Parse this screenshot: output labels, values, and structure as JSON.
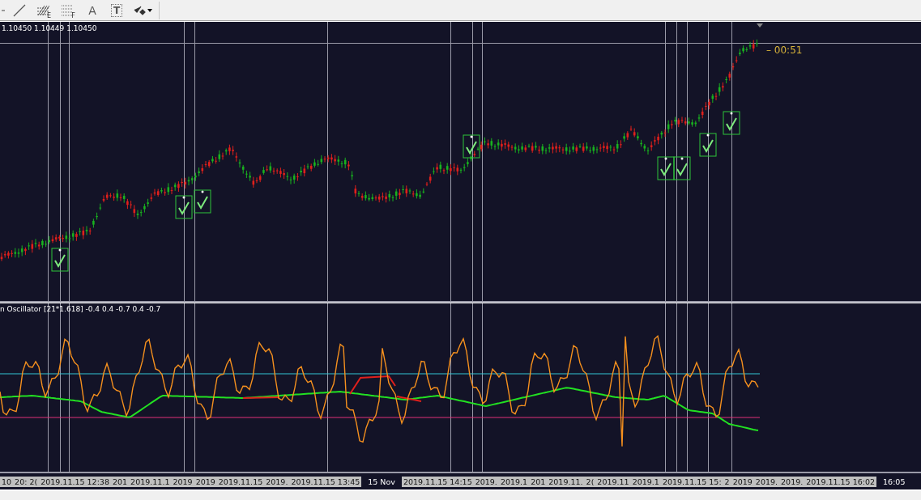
{
  "toolbar": {
    "items": [
      {
        "kind": "line"
      },
      {
        "kind": "fibo",
        "label": "E"
      },
      {
        "kind": "grid",
        "label": "F"
      },
      {
        "kind": "text",
        "label": "A"
      },
      {
        "kind": "textbox",
        "label": "T"
      },
      {
        "kind": "arrows"
      }
    ]
  },
  "price_chart": {
    "ohlc": "1.10450 1.10449 1.10450",
    "timer": "– 00:51"
  },
  "oscillator": {
    "label": "n Oscillator [21*1.618] -0.4 0.4 -0.7 0.4 -0.7"
  },
  "time_axis": [
    {
      "text": "10",
      "kind": "box"
    },
    {
      "text": "20: 2(",
      "kind": "box"
    },
    {
      "text": "2019.11.15 12:38",
      "kind": "box"
    },
    {
      "text": "201",
      "kind": "box"
    },
    {
      "text": "2019.11.1",
      "kind": "box"
    },
    {
      "text": "2019",
      "kind": "box"
    },
    {
      "text": "2019",
      "kind": "box"
    },
    {
      "text": "2019.11.15",
      "kind": "box"
    },
    {
      "text": "2019.",
      "kind": "box"
    },
    {
      "text": "2019.11.15 13:45",
      "kind": "box"
    },
    {
      "text": "15 Nov",
      "kind": "plain"
    },
    {
      "text": "2019.11.15 14:15",
      "kind": "box"
    },
    {
      "text": "2019.",
      "kind": "box"
    },
    {
      "text": "2019.1",
      "kind": "box"
    },
    {
      "text": "201",
      "kind": "box"
    },
    {
      "text": "2019.11.",
      "kind": "box"
    },
    {
      "text": "2(",
      "kind": "box"
    },
    {
      "text": "2019.11",
      "kind": "box"
    },
    {
      "text": "2019.1",
      "kind": "box"
    },
    {
      "text": "2019.11.15 15:",
      "kind": "box"
    },
    {
      "text": "2",
      "kind": "box"
    },
    {
      "text": "2019",
      "kind": "box"
    },
    {
      "text": "2019.",
      "kind": "box"
    },
    {
      "text": "2019.",
      "kind": "box"
    },
    {
      "text": "2019.11.15 16:02",
      "kind": "box"
    },
    {
      "text": "16:05",
      "kind": "plain"
    }
  ]
}
